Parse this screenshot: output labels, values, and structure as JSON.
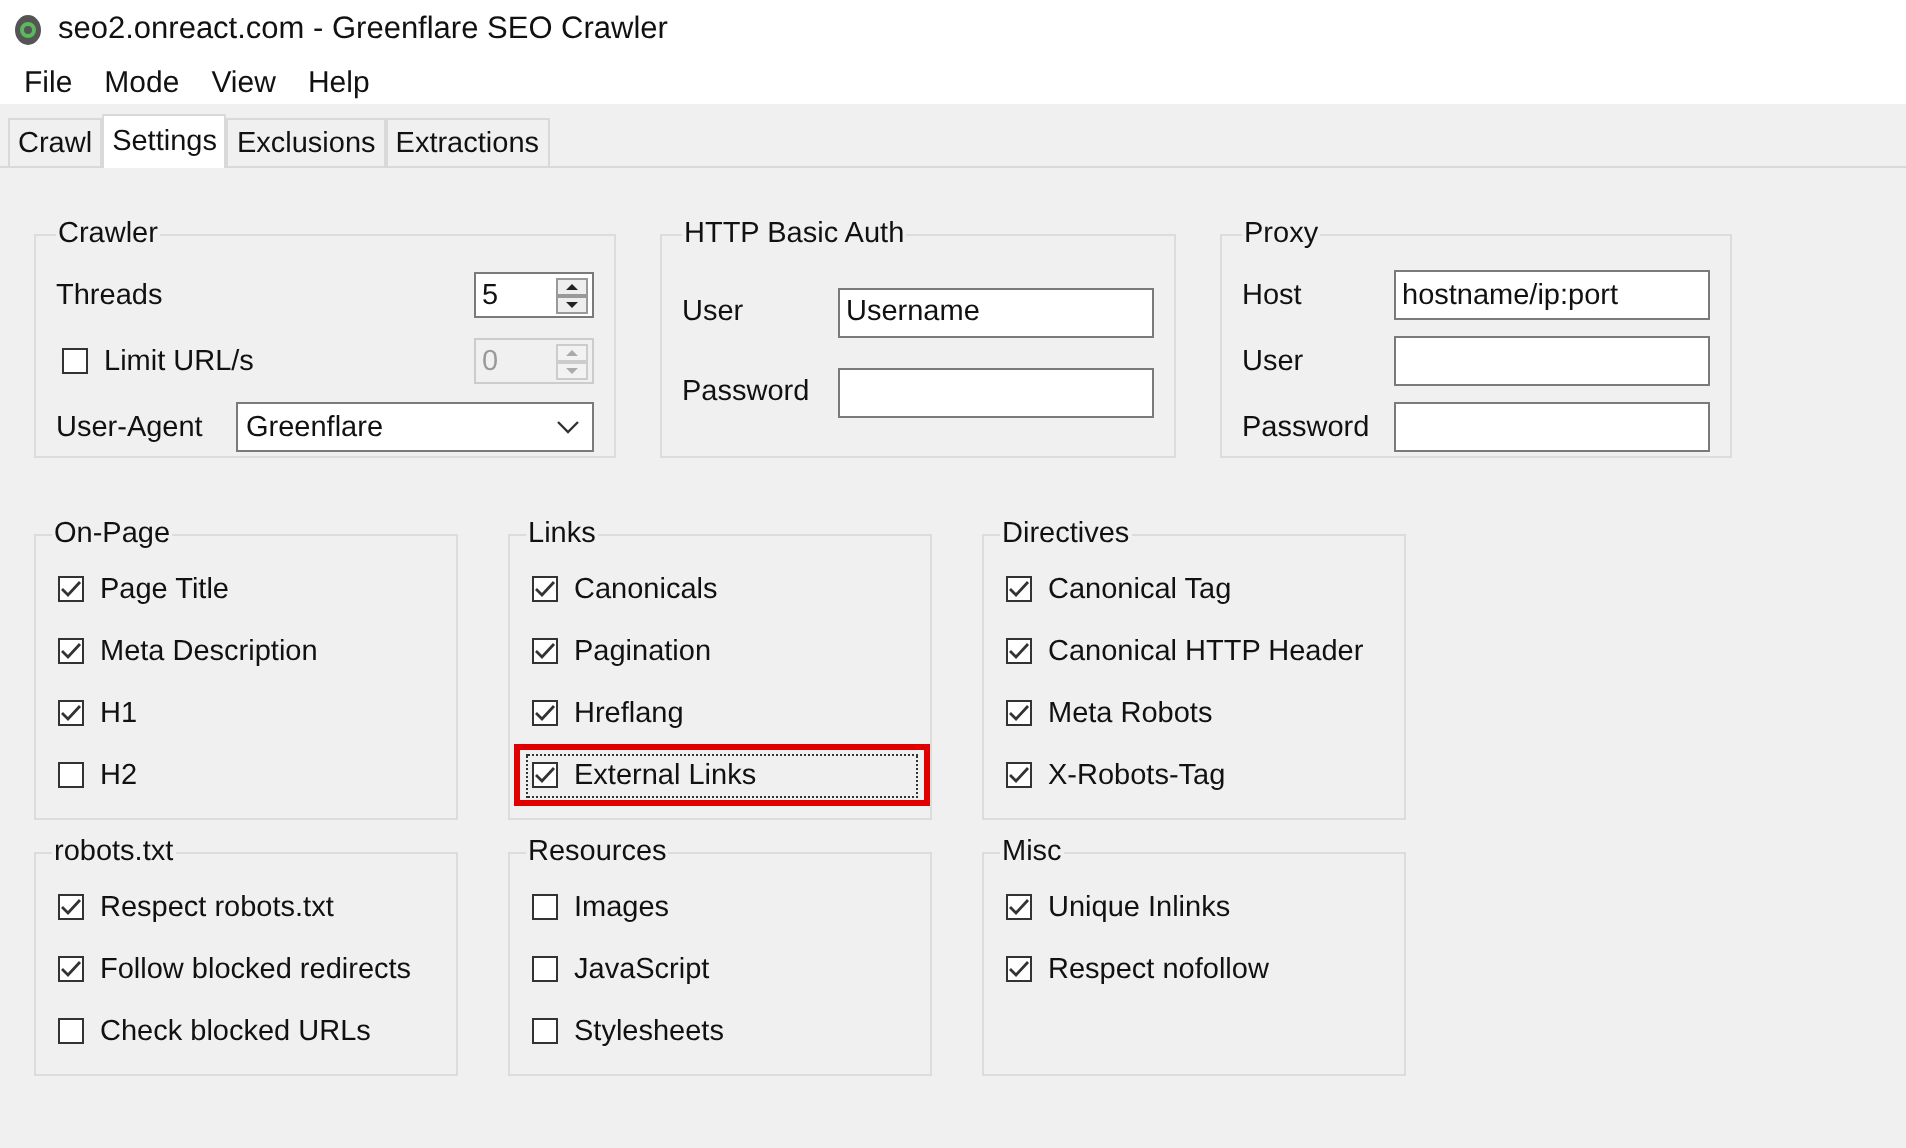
{
  "window": {
    "title": "seo2.onreact.com - Greenflare SEO Crawler"
  },
  "menu": [
    "File",
    "Mode",
    "View",
    "Help"
  ],
  "tabs": [
    {
      "label": "Crawl",
      "selected": false
    },
    {
      "label": "Settings",
      "selected": true
    },
    {
      "label": "Exclusions",
      "selected": false
    },
    {
      "label": "Extractions",
      "selected": false
    }
  ],
  "crawler": {
    "title": "Crawler",
    "threads": {
      "label": "Threads",
      "value": "5"
    },
    "limit": {
      "label": "Limit URL/s",
      "checked": false,
      "value": "0",
      "disabled": true
    },
    "user_agent": {
      "label": "User-Agent",
      "value": "Greenflare"
    }
  },
  "auth": {
    "title": "HTTP Basic Auth",
    "fields": [
      {
        "label": "User",
        "value": "Username"
      },
      {
        "label": "Password"
      }
    ]
  },
  "proxy": {
    "title": "Proxy",
    "fields": [
      {
        "label": "Host",
        "value": "hostname/ip:port"
      },
      {
        "label": "User"
      },
      {
        "label": "Password"
      }
    ]
  },
  "check_groups": [
    {
      "title": "On-Page",
      "items": [
        {
          "label": "Page Title",
          "checked": true,
          "focused": false,
          "highlighted": false
        },
        {
          "label": "Meta Description",
          "checked": true,
          "focused": false,
          "highlighted": false
        },
        {
          "label": "H1",
          "checked": true,
          "focused": false,
          "highlighted": false
        },
        {
          "label": "H2",
          "checked": false,
          "focused": false,
          "highlighted": false
        }
      ]
    },
    {
      "title": "Links",
      "items": [
        {
          "label": "Canonicals",
          "checked": true,
          "focused": false,
          "highlighted": false
        },
        {
          "label": "Pagination",
          "checked": true,
          "focused": false,
          "highlighted": false
        },
        {
          "label": "Hreflang",
          "checked": true,
          "focused": false,
          "highlighted": false
        },
        {
          "label": "External Links",
          "checked": true,
          "focused": true,
          "highlighted": true
        }
      ]
    },
    {
      "title": "Directives",
      "items": [
        {
          "label": "Canonical Tag",
          "checked": true,
          "focused": false,
          "highlighted": false
        },
        {
          "label": "Canonical HTTP Header",
          "checked": true,
          "focused": false,
          "highlighted": false
        },
        {
          "label": "Meta Robots",
          "checked": true,
          "focused": false,
          "highlighted": false
        },
        {
          "label": "X-Robots-Tag",
          "checked": true,
          "focused": false,
          "highlighted": false
        }
      ]
    },
    {
      "title": "robots.txt",
      "items": [
        {
          "label": "Respect robots.txt",
          "checked": true,
          "focused": false,
          "highlighted": false
        },
        {
          "label": "Follow blocked redirects",
          "checked": true,
          "focused": false,
          "highlighted": false
        },
        {
          "label": "Check blocked URLs",
          "checked": false,
          "focused": false,
          "highlighted": false
        }
      ]
    },
    {
      "title": "Resources",
      "items": [
        {
          "label": "Images",
          "checked": false,
          "focused": false,
          "highlighted": false
        },
        {
          "label": "JavaScript",
          "checked": false,
          "focused": false,
          "highlighted": false
        },
        {
          "label": "Stylesheets",
          "checked": false,
          "focused": false,
          "highlighted": false
        }
      ]
    },
    {
      "title": "Misc",
      "items": [
        {
          "label": "Unique Inlinks",
          "checked": true,
          "focused": false,
          "highlighted": false
        },
        {
          "label": "Respect nofollow",
          "checked": true,
          "focused": false,
          "highlighted": false
        }
      ]
    }
  ]
}
